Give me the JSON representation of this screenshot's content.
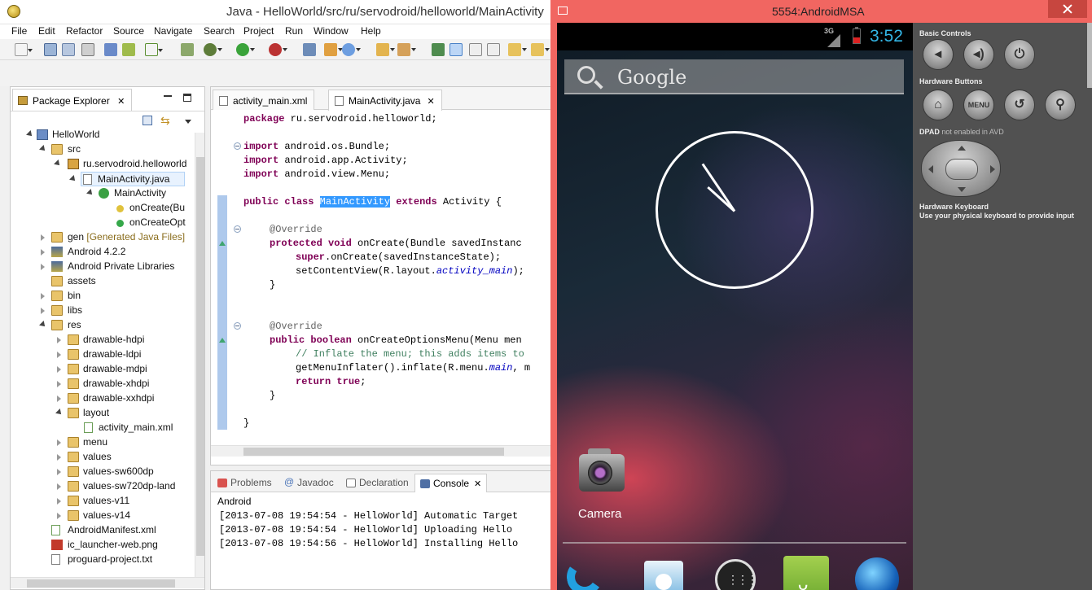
{
  "eclipse": {
    "title": "Java - HelloWorld/src/ru/servodroid/helloworld/MainActivity",
    "menu": [
      "File",
      "Edit",
      "Refactor",
      "Source",
      "Navigate",
      "Search",
      "Project",
      "Run",
      "Window",
      "Help"
    ],
    "package_explorer": {
      "tab_label": "Package Explorer",
      "tree": [
        {
          "label": "HelloWorld",
          "icon": "project-icon"
        },
        {
          "label": "src",
          "icon": "folder-icon"
        },
        {
          "label": "ru.servodroid.helloworld",
          "icon": "package-icon"
        },
        {
          "label": "MainActivity.java",
          "icon": "java-file-icon"
        },
        {
          "label": "MainActivity",
          "icon": "class-icon"
        },
        {
          "label": "onCreate(Bu",
          "icon": "method-icon"
        },
        {
          "label": "onCreateOpt",
          "icon": "method-icon"
        },
        {
          "label": "gen",
          "suffix": "[Generated Java Files]",
          "icon": "folder-icon"
        },
        {
          "label": "Android 4.2.2",
          "icon": "library-icon"
        },
        {
          "label": "Android Private Libraries",
          "icon": "library-icon"
        },
        {
          "label": "assets",
          "icon": "folder-icon"
        },
        {
          "label": "bin",
          "icon": "folder-icon"
        },
        {
          "label": "libs",
          "icon": "folder-icon"
        },
        {
          "label": "res",
          "icon": "folder-icon"
        },
        {
          "label": "drawable-hdpi",
          "icon": "folder-icon"
        },
        {
          "label": "drawable-ldpi",
          "icon": "folder-icon"
        },
        {
          "label": "drawable-mdpi",
          "icon": "folder-icon"
        },
        {
          "label": "drawable-xhdpi",
          "icon": "folder-icon"
        },
        {
          "label": "drawable-xxhdpi",
          "icon": "folder-icon"
        },
        {
          "label": "layout",
          "icon": "folder-icon"
        },
        {
          "label": "activity_main.xml",
          "icon": "xml-file-icon"
        },
        {
          "label": "menu",
          "icon": "folder-icon"
        },
        {
          "label": "values",
          "icon": "folder-icon"
        },
        {
          "label": "values-sw600dp",
          "icon": "folder-icon"
        },
        {
          "label": "values-sw720dp-land",
          "icon": "folder-icon"
        },
        {
          "label": "values-v11",
          "icon": "folder-icon"
        },
        {
          "label": "values-v14",
          "icon": "folder-icon"
        },
        {
          "label": "AndroidManifest.xml",
          "icon": "xml-file-icon"
        },
        {
          "label": "ic_launcher-web.png",
          "icon": "image-file-icon"
        },
        {
          "label": "proguard-project.txt",
          "icon": "text-file-icon"
        }
      ]
    },
    "editor": {
      "tabs": [
        "activity_main.xml",
        "MainActivity.java"
      ],
      "code": {
        "package_kw": "package",
        "package_name": " ru.servodroid.helloworld;",
        "import_kw": "import",
        "import1": " android.os.Bundle;",
        "import2": " android.app.Activity;",
        "import3": " android.view.Menu;",
        "public_kw": "public",
        "class_kw": "class",
        "class_name": "MainActivity",
        "extends_kw": "extends",
        "extends_rest": " Activity {",
        "override": "@Override",
        "protected_kw": "protected",
        "void_kw": "void",
        "oncreate_rest": " onCreate(Bundle savedInstanc",
        "super_kw": "super",
        "super_rest": ".onCreate(savedInstanceState);",
        "setcontent_a": "setContentView(R.layout.",
        "setcontent_b": "activity_main",
        "setcontent_c": ");",
        "close_brace": "}",
        "boolean_kw": "boolean",
        "oncreateopt_rest": " onCreateOptionsMenu(Menu men",
        "comment": "// Inflate the menu; this adds items to",
        "inflate_a": "getMenuInflater().inflate(R.menu.",
        "inflate_b": "main",
        "inflate_c": ", m",
        "return_kw": "return",
        "true_kw": "true",
        "semicolon": ";"
      }
    },
    "console": {
      "tabs": [
        "Problems",
        "Javadoc",
        "Declaration",
        "Console"
      ],
      "label": "Android",
      "lines": [
        "[2013-07-08 19:54:54 - HelloWorld] Automatic Target",
        "[2013-07-08 19:54:54 - HelloWorld] Uploading Hello",
        "[2013-07-08 19:54:56 - HelloWorld] Installing Hello"
      ]
    }
  },
  "emulator": {
    "title": "5554:AndroidMSA",
    "status": {
      "network": "3G",
      "time": "3:52"
    },
    "search_label": "Google",
    "clock": {
      "hour": 10,
      "minute": 52
    },
    "camera_label": "Camera",
    "dock": [
      "phone-icon",
      "people-icon",
      "apps-icon",
      "market-icon",
      "browser-icon"
    ],
    "controls": {
      "basic_label": "Basic Controls",
      "hardware_label": "Hardware Buttons",
      "menu_label": "MENU",
      "dpad_label": "DPAD",
      "dpad_note": "not enabled in AVD",
      "keyboard_label": "Hardware Keyboard",
      "keyboard_note": "Use your physical keyboard to provide input"
    },
    "colors": {
      "window": "#f16661",
      "clock_text": "#33b5e5",
      "controls_bg": "#515151"
    }
  }
}
